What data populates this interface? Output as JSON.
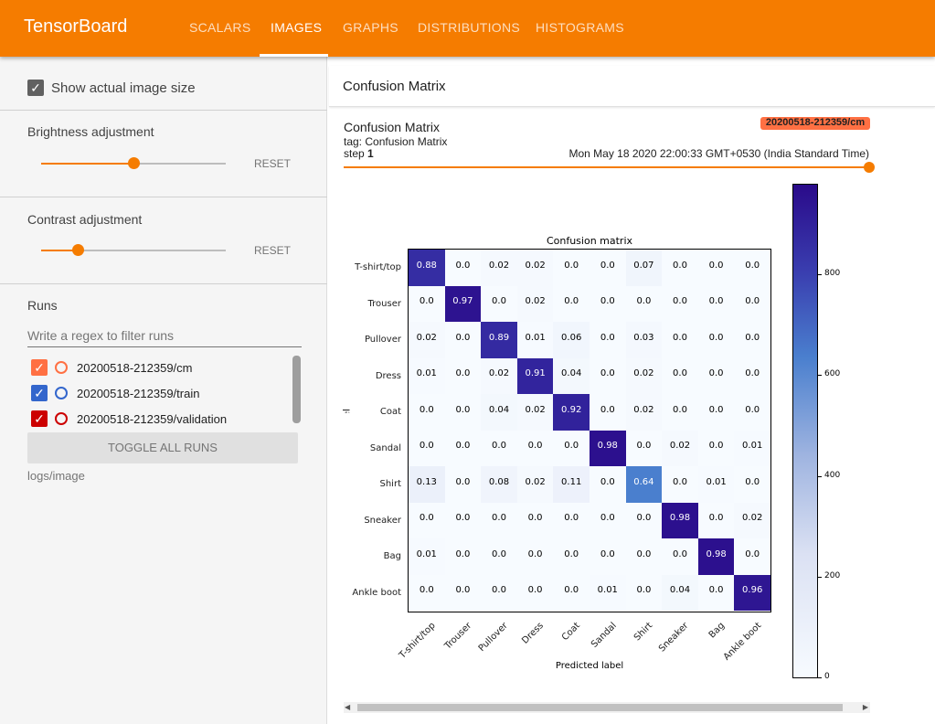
{
  "header": {
    "title": "TensorBoard",
    "tabs": [
      "SCALARS",
      "IMAGES",
      "GRAPHS",
      "DISTRIBUTIONS",
      "HISTOGRAMS"
    ],
    "active_tab": "IMAGES",
    "color": "#f57c00"
  },
  "sidebar": {
    "show_actual_size": {
      "label": "Show actual image size",
      "checked": true
    },
    "brightness": {
      "label": "Brightness adjustment",
      "value": 0.5,
      "reset": "RESET"
    },
    "contrast": {
      "label": "Contrast adjustment",
      "value": 0.2,
      "reset": "RESET"
    },
    "runs": {
      "title": "Runs",
      "filter_placeholder": "Write a regex to filter runs",
      "items": [
        {
          "name": "20200518-212359/cm",
          "color": "#ff7043",
          "checked": true
        },
        {
          "name": "20200518-212359/train",
          "color": "#3366cc",
          "checked": true
        },
        {
          "name": "20200518-212359/validation",
          "color": "#cc0000",
          "checked": true
        }
      ],
      "toggle_all": "TOGGLE ALL RUNS",
      "logdir": "logs/image"
    }
  },
  "main": {
    "section_title": "Confusion Matrix",
    "card": {
      "title": "Confusion Matrix",
      "tag": "tag: Confusion Matrix",
      "step_label": "step",
      "step": "1",
      "run_badge": "20200518-212359/cm",
      "timestamp": "Mon May 18 2020 22:00:33 GMT+0530 (India Standard Time)"
    }
  },
  "chart_data": {
    "type": "heatmap",
    "title": "Confusion matrix",
    "xlabel": "Predicted label",
    "ylabel": "True label",
    "labels": [
      "T-shirt/top",
      "Trouser",
      "Pullover",
      "Dress",
      "Coat",
      "Sandal",
      "Shirt",
      "Sneaker",
      "Bag",
      "Ankle boot"
    ],
    "values": [
      [
        "0.88",
        "0.0",
        "0.02",
        "0.02",
        "0.0",
        "0.0",
        "0.07",
        "0.0",
        "0.0",
        "0.0"
      ],
      [
        "0.0",
        "0.97",
        "0.0",
        "0.02",
        "0.0",
        "0.0",
        "0.0",
        "0.0",
        "0.0",
        "0.0"
      ],
      [
        "0.02",
        "0.0",
        "0.89",
        "0.01",
        "0.06",
        "0.0",
        "0.03",
        "0.0",
        "0.0",
        "0.0"
      ],
      [
        "0.01",
        "0.0",
        "0.02",
        "0.91",
        "0.04",
        "0.0",
        "0.02",
        "0.0",
        "0.0",
        "0.0"
      ],
      [
        "0.0",
        "0.0",
        "0.04",
        "0.02",
        "0.92",
        "0.0",
        "0.02",
        "0.0",
        "0.0",
        "0.0"
      ],
      [
        "0.0",
        "0.0",
        "0.0",
        "0.0",
        "0.0",
        "0.98",
        "0.0",
        "0.02",
        "0.0",
        "0.01"
      ],
      [
        "0.13",
        "0.0",
        "0.08",
        "0.02",
        "0.11",
        "0.0",
        "0.64",
        "0.0",
        "0.01",
        "0.0"
      ],
      [
        "0.0",
        "0.0",
        "0.0",
        "0.0",
        "0.0",
        "0.0",
        "0.0",
        "0.98",
        "0.0",
        "0.02"
      ],
      [
        "0.01",
        "0.0",
        "0.0",
        "0.0",
        "0.0",
        "0.0",
        "0.0",
        "0.0",
        "0.98",
        "0.0"
      ],
      [
        "0.0",
        "0.0",
        "0.0",
        "0.0",
        "0.0",
        "0.01",
        "0.0",
        "0.04",
        "0.0",
        "0.96"
      ]
    ],
    "colorbar": {
      "ticks": [
        "0",
        "200",
        "400",
        "600",
        "800"
      ],
      "range": [
        0,
        980
      ]
    }
  }
}
